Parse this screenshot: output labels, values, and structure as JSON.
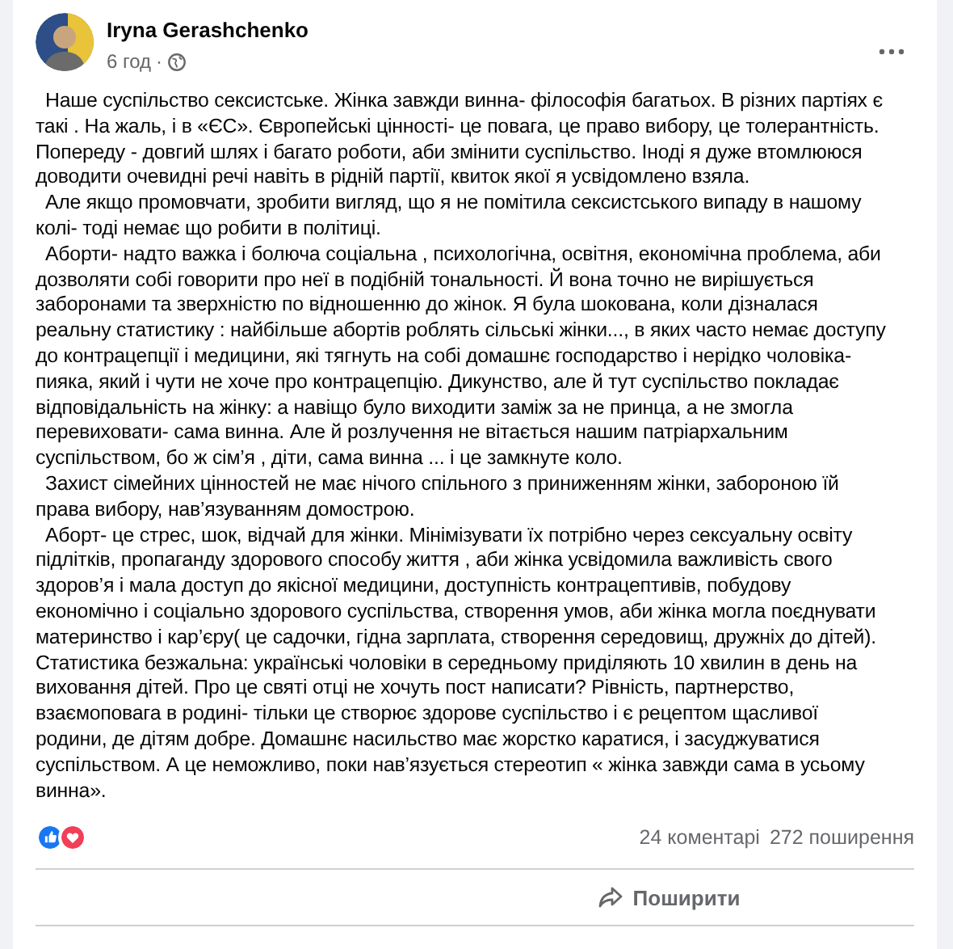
{
  "post": {
    "author": "Iryna Gerashchenko",
    "time": "6 год",
    "separator": "·",
    "paragraphs": [
      "Наше суспільство сексистське.  Жінка завжди винна- філософія багатьох. В різних партіях є\nтакі  . На жаль, і в «ЄС». Європейські цінності- це повага, це право вибору, це толерантність.\nПопереду - довгий шлях і багато роботи, аби змінити суспільство. Іноді я дуже втомлююся\nдоводити очевидні речі навіть в рідній партії, квиток якої я усвідомлено взяла.",
      "Але якщо промовчати, зробити вигляд, що я не помітила сексистського випаду в нашому\nколі- тоді  немає що робити в політиці.",
      "Аборти- надто важка і болюча соціальна , психологічна, освітня, економічна проблема, аби\nдозволяти собі говорити про неї в подібній тональності. Й вона точно не вирішується\nзаборонами  та зверхністю по відношенню до жінок. Я була шокована, коли дізналася\nреальну статистику :  найбільше абортів роблять сільські жінки..., в яких часто немає доступу\nдо контрацепції і медицини, які тягнуть на собі домашнє господарство і нерідко чоловіка-\nпияка, який і чути не хоче про контрацепцію. Дикунство, але й тут суспільство покладає\nвідповідальність на жінку: а навіщо було виходити заміж за не принца, а не змогла\nперевиховати- сама винна. Але й розлучення не вітається нашим патріархальним\nсуспільством, бо ж сім’я , діти, сама винна ... і це замкнуте коло.",
      "Захист сімейних цінностей не має нічого спільного з приниженням жінки, забороною їй\nправа вибору, нав’язуванням домострою.",
      "Аборт- це стрес, шок, відчай для жінки. Мінімізувати  їх потрібно  через сексуальну освіту\nпідлітків, пропаганду здорового способу життя , аби жінка усвідомила важливість свого\nздоров’я і мала доступ до якісної медицини, доступність контрацептивів, побудову\nекономічно і соціально здорового суспільства, створення умов, аби жінка могла поєднувати\nматеринство і кар’єру( це садочки, гідна зарплата, створення середовищ, дружніх до дітей).\nСтатистика безжальна: українські чоловіки в середньому приділяють 10 хвилин в день на\nвиховання дітей. Про це святі отці не хочуть пост написати? Рівність, партнерство,\nвзаємоповага в родині-  тільки це створює здорове суспільство і є рецептом щасливої\nродини, де дітям добре. Домашнє насильство має жорстко каратися, і засуджуватися\nсуспільством. А це неможливо, поки нав’язується стереотип « жінка завжди сама в усьому\nвинна»."
    ],
    "reactions": [
      {
        "kind": "like"
      },
      {
        "kind": "love"
      }
    ],
    "comments": "24 коментарі",
    "shares": "272 поширення",
    "share_button": "Поширити"
  }
}
